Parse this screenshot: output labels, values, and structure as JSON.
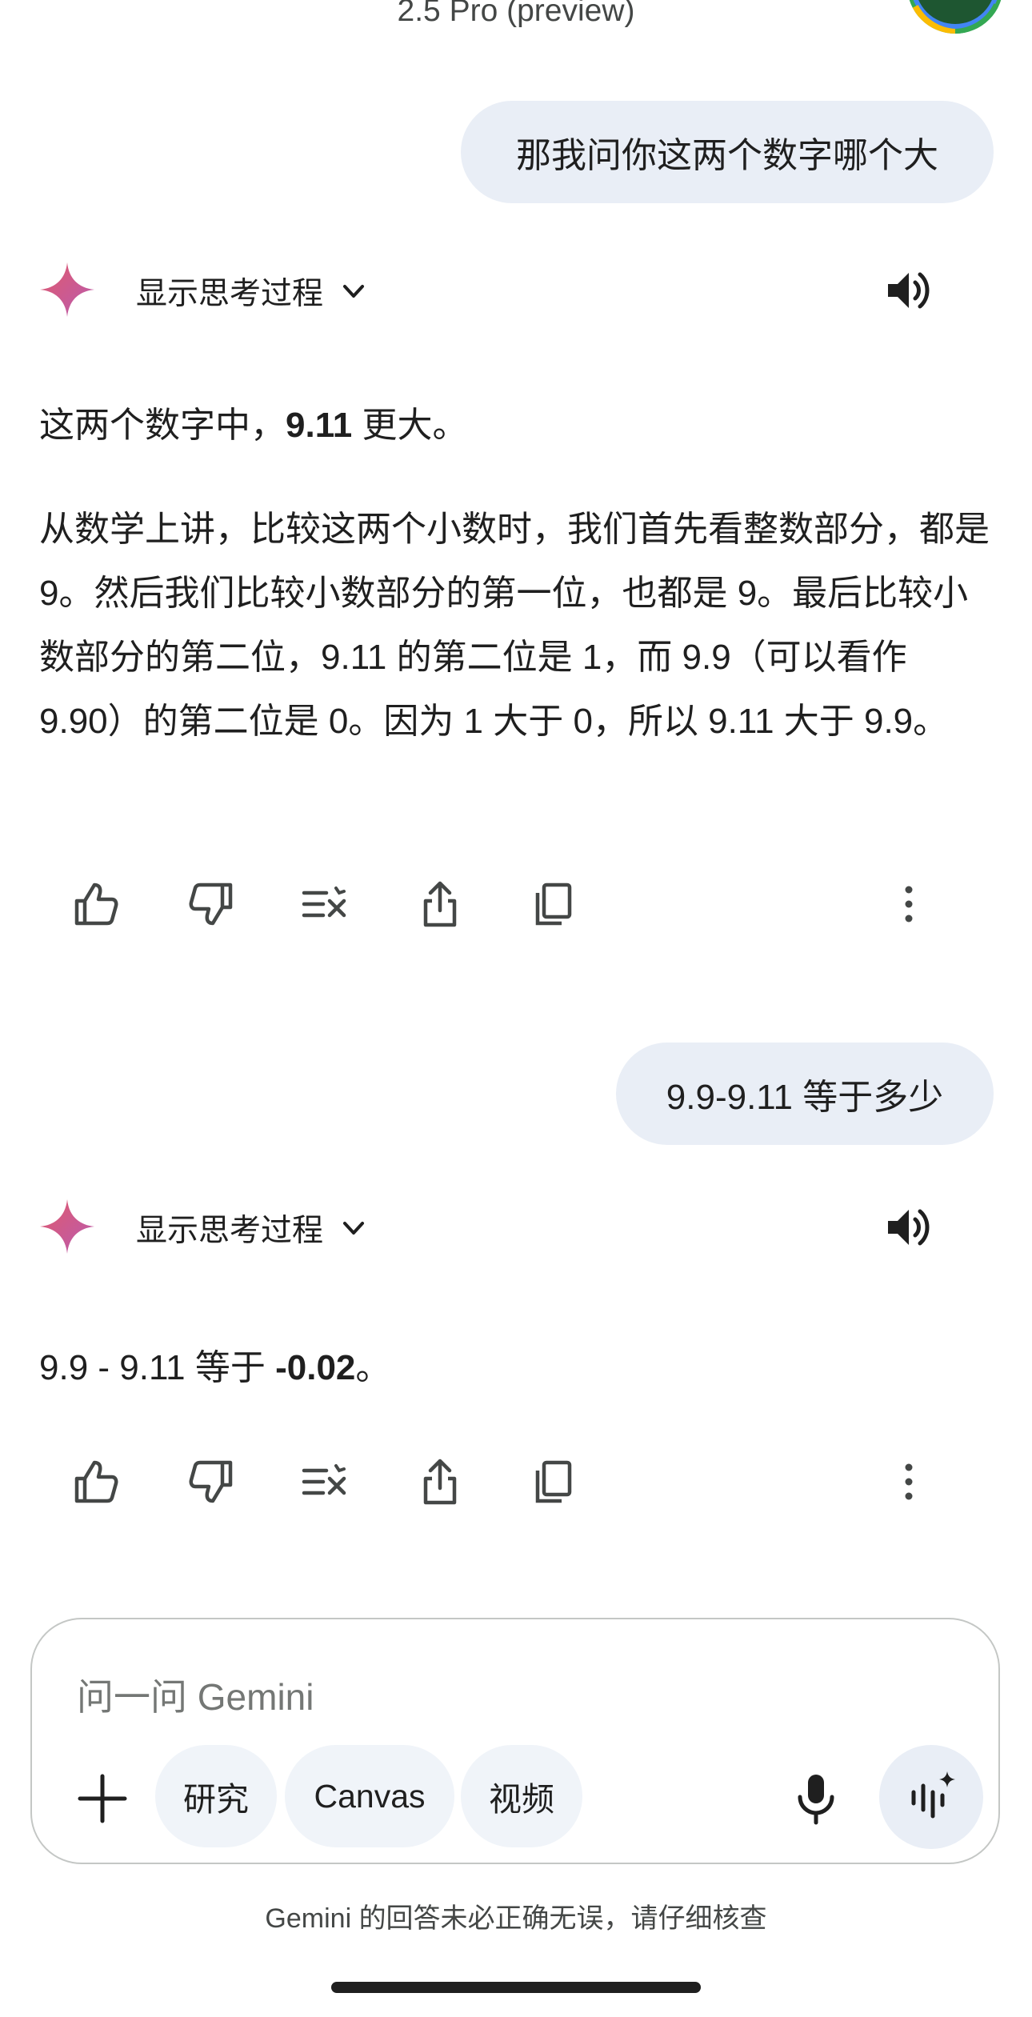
{
  "header": {
    "model_title": "2.5 Pro (preview)"
  },
  "conversation": [
    {
      "user_message": "那我问你这两个数字哪个大",
      "show_thinking_label": "显示思考过程",
      "response_paragraphs": [
        "这两个数字中，9.11 更大。",
        "从数学上讲，比较这两个小数时，我们首先看整数部分，都是 9。然后我们比较小数部分的第一位，也都是 9。最后比较小数部分的第二位，9.11 的第二位是 1，而 9.9（可以看作 9.90）的第二位是 0。因为 1 大于 0，所以 9.11 大于 9.9。"
      ],
      "response_bold": "9.11"
    },
    {
      "user_message": "9.9-9.11 等于多少",
      "show_thinking_label": "显示思考过程",
      "response_prefix": "9.9 - 9.11 等于 ",
      "response_bold": "-0.02",
      "response_suffix": "。"
    }
  ],
  "response_actions": [
    "thumb-up-icon",
    "thumb-down-icon",
    "modify-response-icon",
    "share-icon",
    "copy-icon",
    "more-vert-icon"
  ],
  "input": {
    "placeholder": "问一问 Gemini",
    "chips": [
      "研究",
      "Canvas",
      "视频"
    ]
  },
  "footer": {
    "disclaimer": "Gemini 的回答未必正确无误，请仔细核查"
  },
  "colors": {
    "bubble": "#e9eef6",
    "chip": "#f0f4f9",
    "text": "#1f1f1f",
    "muted": "#747775",
    "avatar": "#1e5631"
  }
}
